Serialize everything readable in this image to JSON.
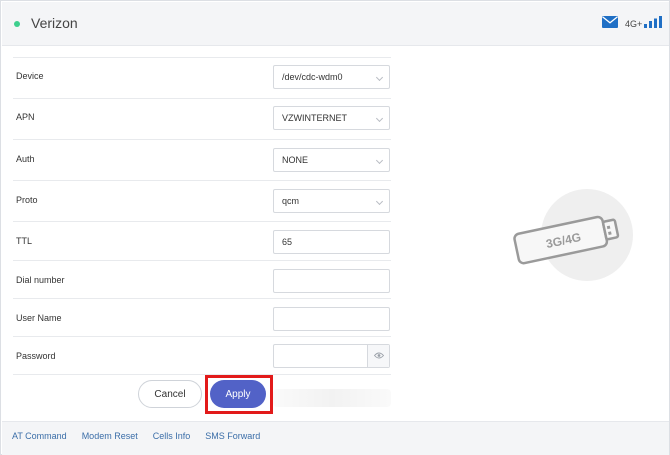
{
  "header": {
    "carrier": "Verizon",
    "network_type": "4G+",
    "status_color": "#3ecf8e",
    "icons": [
      "mail-icon",
      "signal-bars-icon"
    ]
  },
  "form": {
    "fields": [
      {
        "label": "Device",
        "type": "select",
        "value": "/dev/cdc-wdm0"
      },
      {
        "label": "APN",
        "type": "select",
        "value": "VZWINTERNET"
      },
      {
        "label": "Auth",
        "type": "select",
        "value": "NONE"
      },
      {
        "label": "Proto",
        "type": "select",
        "value": "qcm"
      },
      {
        "label": "TTL",
        "type": "text",
        "value": "65"
      },
      {
        "label": "Dial number",
        "type": "text",
        "value": ""
      },
      {
        "label": "User Name",
        "type": "text",
        "value": ""
      },
      {
        "label": "Password",
        "type": "password",
        "value": ""
      }
    ]
  },
  "actions": {
    "cancel_label": "Cancel",
    "apply_label": "Apply",
    "apply_color": "#5262c7",
    "highlight_color": "#e21a1a"
  },
  "illustration": {
    "label": "3G/4G",
    "icon": "usb-modem-icon"
  },
  "footer": {
    "links": [
      "AT Command",
      "Modem Reset",
      "Cells Info",
      "SMS Forward"
    ]
  }
}
